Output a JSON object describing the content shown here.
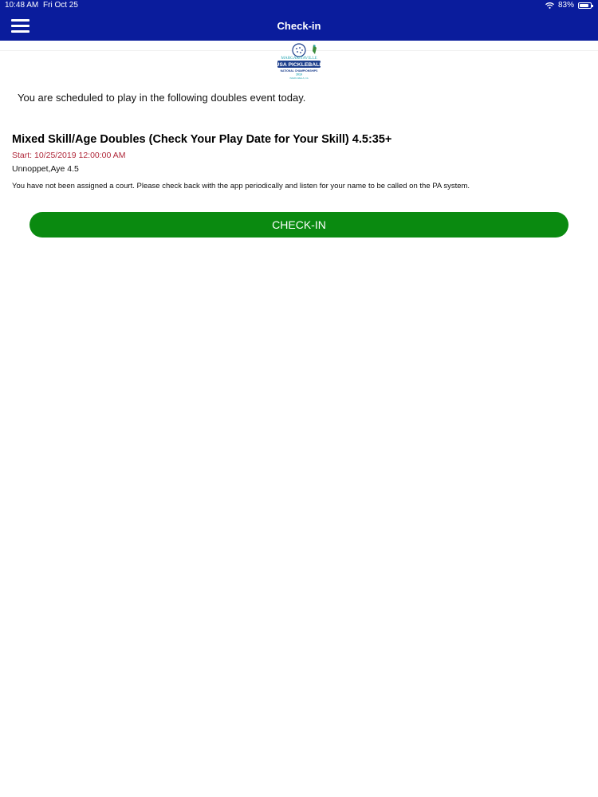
{
  "status_bar": {
    "time": "10:48 AM",
    "date": "Fri Oct 25",
    "battery": "83%",
    "battery_level": 0.83
  },
  "nav": {
    "title": "Check-in",
    "menu_icon": "hamburger-menu-icon"
  },
  "logo": {
    "brand_line": "MARGARITAVILLE",
    "main_line": "USA PICKLEBALL",
    "sub_line": "NATIONAL CHAMPIONSHIPS",
    "year": "2019",
    "location": "INDIAN WELLS, CA",
    "colors": {
      "navy": "#1d3f8c",
      "teal": "#2aa7b4",
      "green": "#3c8c3c"
    }
  },
  "main": {
    "intro": "You are scheduled to play in the following doubles event today.",
    "event": {
      "title": "Mixed Skill/Age Doubles (Check Your Play Date for Your Skill) 4.5:35+",
      "start": "Start: 10/25/2019 12:00:00 AM",
      "players": "Unnoppet,Aye 4.5",
      "note": "You have not been assigned a court. Please check back with the app periodically and listen for your name to be called on the PA system."
    },
    "checkin_button_label": "CHECK-IN"
  },
  "colors": {
    "nav_bar": "#0a1c9c",
    "button": "#0a8a10",
    "start_text": "#b0283a"
  }
}
